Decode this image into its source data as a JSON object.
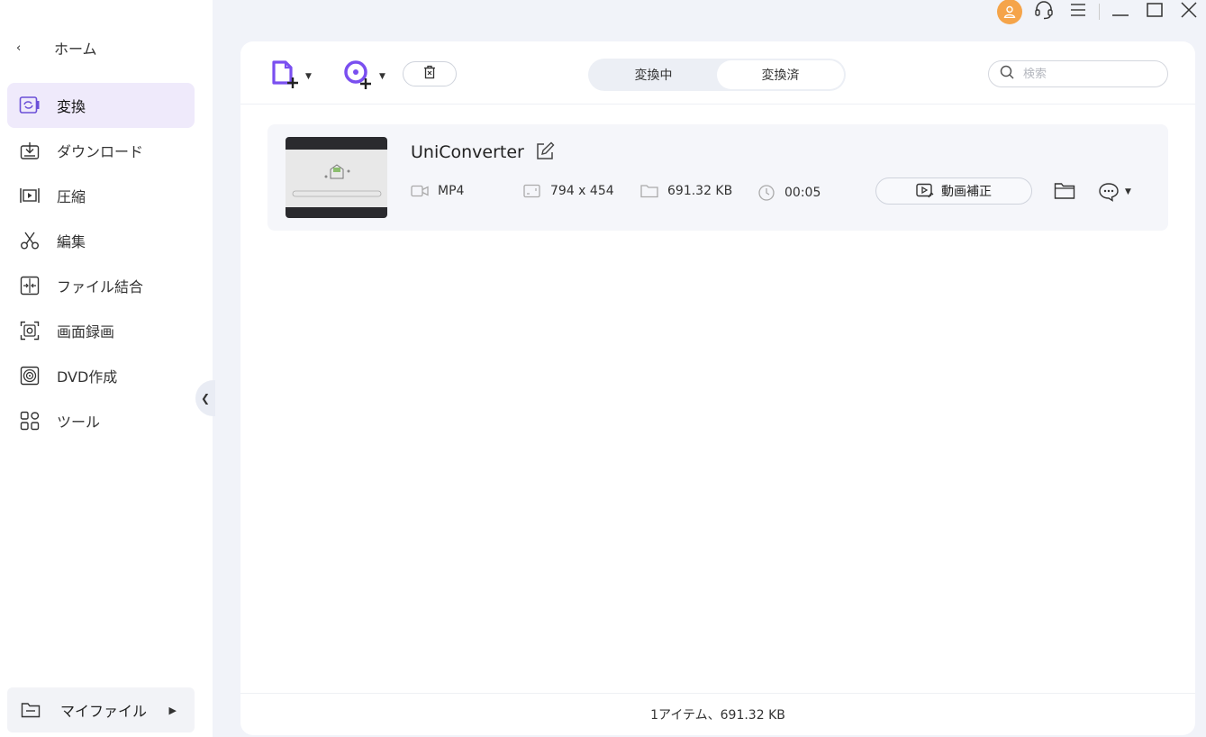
{
  "sidebar": {
    "home_label": "ホーム",
    "items": [
      {
        "label": "変換",
        "icon": "convert-icon",
        "active": true
      },
      {
        "label": "ダウンロード",
        "icon": "download-icon"
      },
      {
        "label": "圧縮",
        "icon": "compress-icon"
      },
      {
        "label": "編集",
        "icon": "scissors-icon"
      },
      {
        "label": "ファイル結合",
        "icon": "merge-icon"
      },
      {
        "label": "画面録画",
        "icon": "screen-record-icon"
      },
      {
        "label": "DVD作成",
        "icon": "dvd-icon"
      },
      {
        "label": "ツール",
        "icon": "tools-icon"
      }
    ],
    "my_files_label": "マイファイル"
  },
  "toolbar": {
    "tabs": [
      "変換中",
      "変換済"
    ],
    "selected_tab": "変換済",
    "search_placeholder": "検索"
  },
  "file": {
    "name": "UniConverter",
    "format": "MP4",
    "resolution": "794 x 454",
    "size": "691.32 KB",
    "duration": "00:05",
    "enhance_label": "動画補正"
  },
  "footer": {
    "summary": "1アイテム、691.32 KB"
  },
  "colors": {
    "accent": "#7a4ff0",
    "avatar": "#f5a44a",
    "active_nav_bg": "#efeafb"
  }
}
